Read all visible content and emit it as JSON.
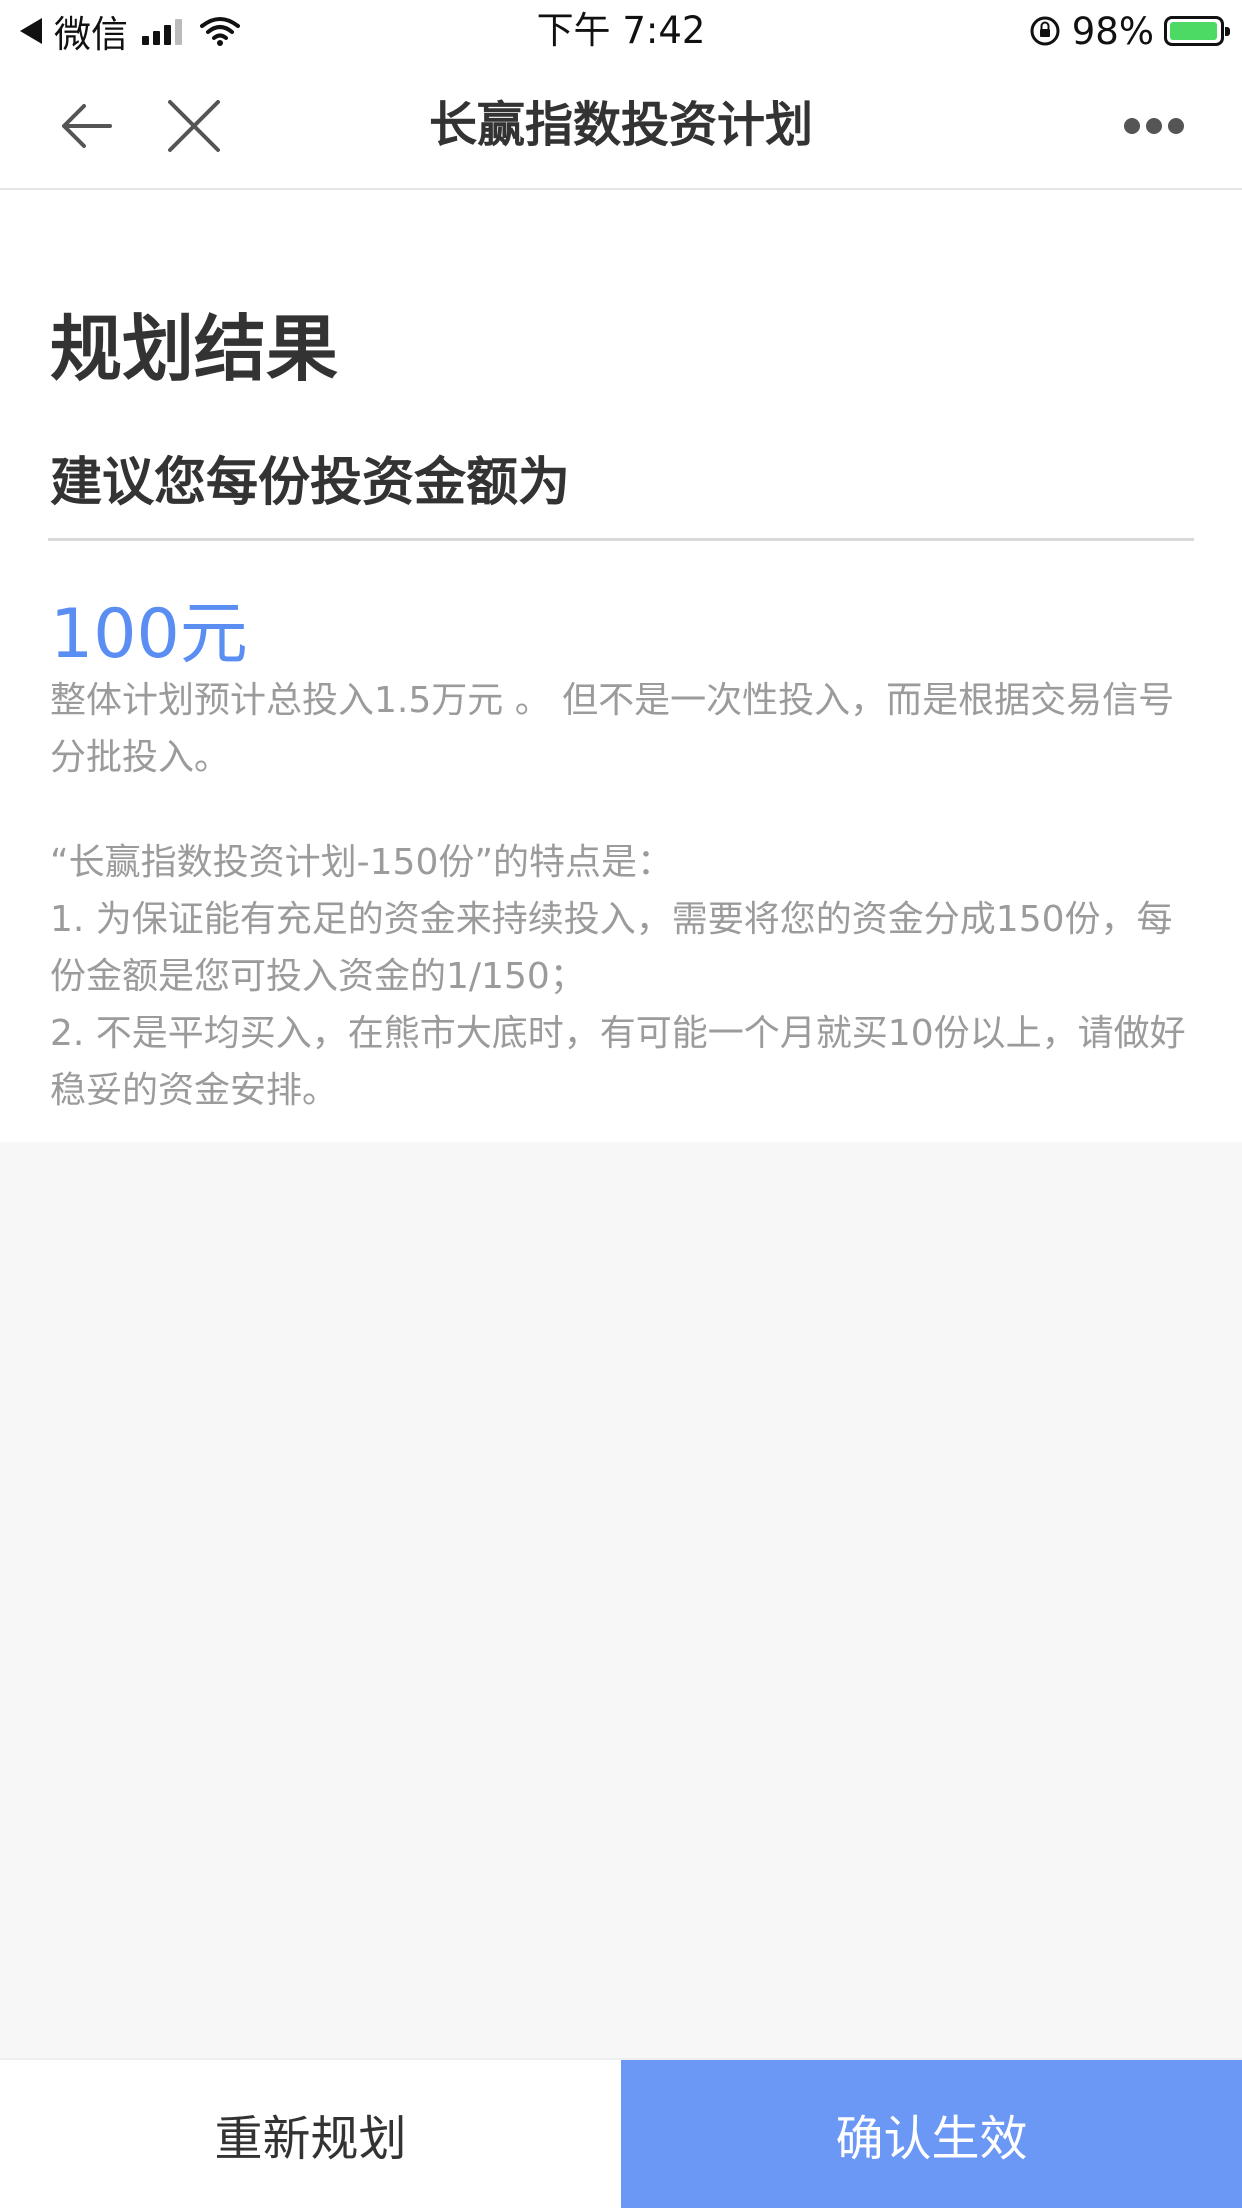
{
  "status_bar": {
    "carrier": "微信",
    "time": "下午 7:42",
    "battery_percent": "98%",
    "battery_level": 0.98
  },
  "nav": {
    "title": "长赢指数投资计划"
  },
  "result": {
    "title": "规划结果",
    "suggest_label": "建议您每份投资金额为",
    "amount": "100元",
    "description": "整体计划预计总投入1.5万元 。 但不是一次性投入，而是根据交易信号分批投入。"
  },
  "features": {
    "heading": "“长赢指数投资计划-150份”的特点是：",
    "point_1": "1. 为保证能有充足的资金来持续投入，需要将您的资金分成150份，每份金额是您可投入资金的1/150；",
    "point_2": "2. 不是平均买入，在熊市大底时，有可能一个月就买10份以上，请做好稳妥的资金安排。"
  },
  "actions": {
    "replan_label": "重新规划",
    "confirm_label": "确认生效"
  },
  "colors": {
    "accent": "#5b8ef2",
    "confirm_bg": "#6b97f5",
    "battery": "#4cd964"
  }
}
